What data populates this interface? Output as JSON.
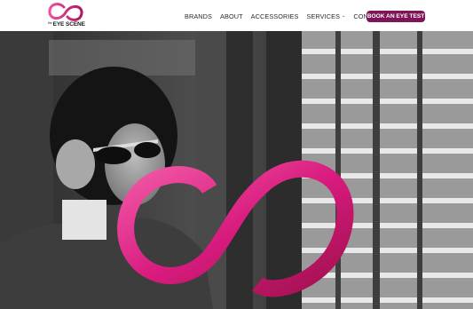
{
  "brand": {
    "logo_prefix": "the",
    "logo_name": "EYE SCENE",
    "accent": "#d81b7f",
    "accent_dark": "#7f1456"
  },
  "nav": {
    "items": [
      {
        "label": "BRANDS"
      },
      {
        "label": "ABOUT"
      },
      {
        "label": "ACCESSORIES"
      },
      {
        "label": "SERVICES",
        "has_dropdown": true
      },
      {
        "label": "CONTACT"
      }
    ],
    "cta_label": "BOOK AN EYE TEST"
  },
  "hero": {
    "image": "black-and-white photo of woman lowering sunglasses beside window shutters",
    "overlay": "brand infinity-loop mark in pink gradient"
  },
  "icons": {
    "dropdown": "chevron-down-icon",
    "logo": "infinity-loop-logo-icon"
  }
}
